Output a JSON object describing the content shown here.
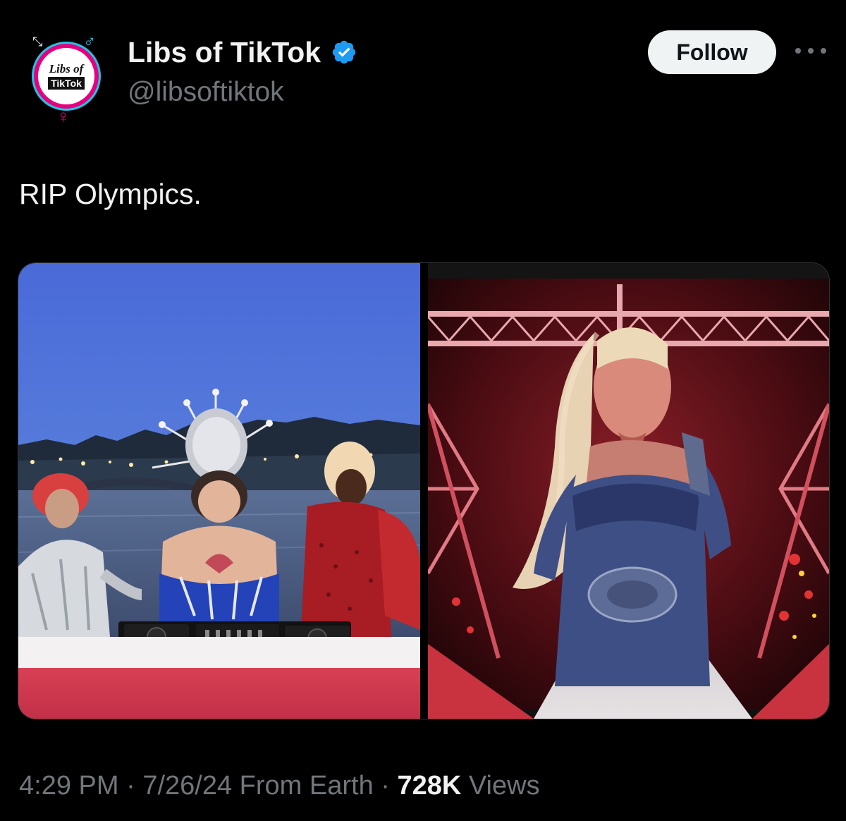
{
  "author": {
    "avatar_line1": "Libs of",
    "avatar_line2": "TikTok",
    "display_name": "Libs of TikTok",
    "handle": "@libsoftiktok",
    "verified": true
  },
  "actions": {
    "follow_label": "Follow"
  },
  "tweet": {
    "text": "RIP Olympics."
  },
  "meta": {
    "time": "4:29 PM",
    "sep1": " · ",
    "date": "7/26/24",
    "source": " From Earth",
    "sep2": " · ",
    "views_count": "728K",
    "views_label": " Views"
  },
  "colors": {
    "background": "#000000",
    "verified_blue": "#1d9bf0",
    "follow_bg": "#eff3f4",
    "secondary_text": "#71767b"
  }
}
